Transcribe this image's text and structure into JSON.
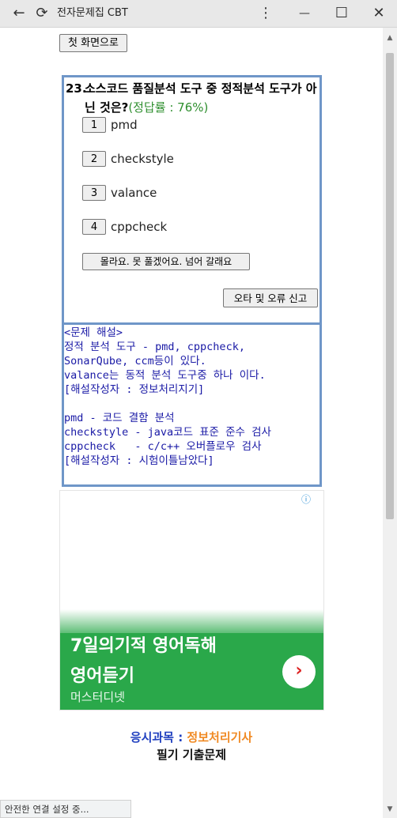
{
  "window": {
    "title": "전자문제집 CBT",
    "back_icon": "←",
    "reload_icon": "⟳",
    "menu_icon": "⋮",
    "minimize_icon": "—",
    "maximize_icon": "☐",
    "close_icon": "✕"
  },
  "page": {
    "home_button": "첫 화면으로",
    "question": {
      "number": "23.",
      "text": "소스코드 품질분석 도구 중 정적분석 도구가 아닌 것은?",
      "rate": "(정답률 : 76%)",
      "options": [
        {
          "num": "1",
          "text": "pmd"
        },
        {
          "num": "2",
          "text": "checkstyle"
        },
        {
          "num": "3",
          "text": "valance"
        },
        {
          "num": "4",
          "text": "cppcheck"
        }
      ],
      "skip_button": "몰라요. 못 풀겠어요. 넘어 갈래요",
      "report_button": "오타 및 오류 신고"
    },
    "explanation": {
      "lines": [
        "<문제 해설>",
        "정적 분석 도구 - pmd, cppcheck,",
        "SonarQube, ccm등이 있다.",
        "valance는 동적 분석 도구중 하나 이다.",
        "[해설작성자 : 정보처리지기]",
        "",
        "pmd - 코드 결함 분석",
        "checkstyle - java코드 표준 준수 검사",
        "cppcheck   - c/c++ 오버플로우 검사",
        "[해설작성자 : 시험이틀남았다]"
      ]
    },
    "ad": {
      "info_icon": "ⓘ",
      "headline1": "7일의기적 영어독해",
      "headline2": "영어듣기",
      "brand": "머스터디넷",
      "go_icon": "›"
    },
    "footer": {
      "subject_label": "응시과목 : ",
      "subject_value": "정보처리기사",
      "exam_type": "필기 기출문제"
    },
    "status_text": "안전한 연결 설정 중..."
  },
  "colors": {
    "accent_border": "#6f96c8",
    "explanation_text": "#1a1aa6",
    "rate_text": "#2f8f2f",
    "subject_label": "#1f3fbf",
    "subject_value": "#f08a24",
    "ad_green": "#2aa84a"
  }
}
